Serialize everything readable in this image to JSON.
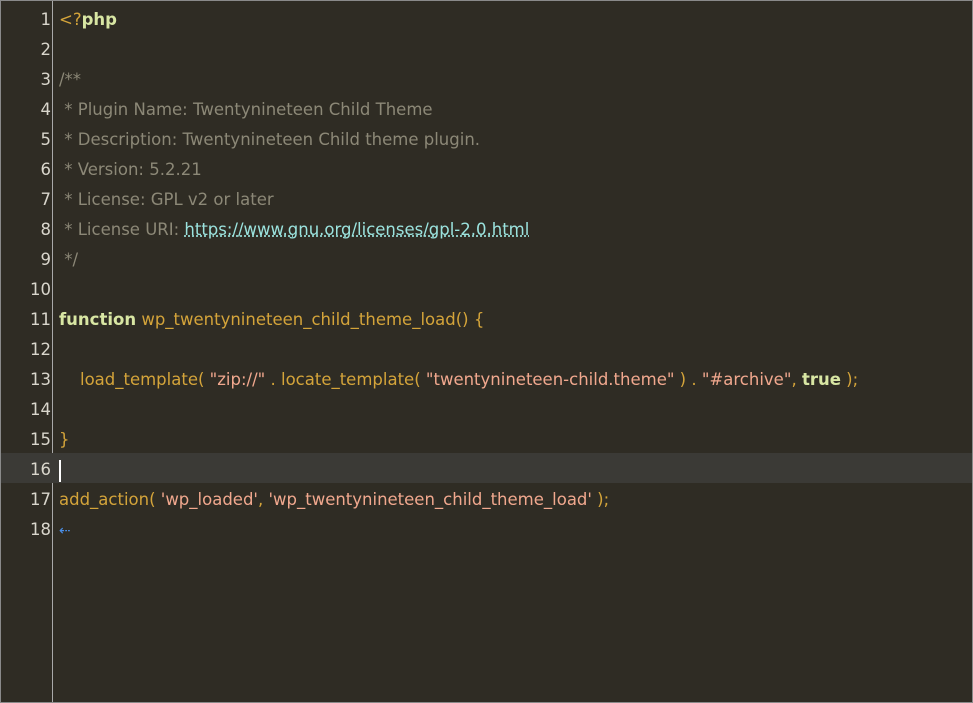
{
  "editor": {
    "lines": [
      {
        "num": "1",
        "parts": [
          {
            "t": "<?",
            "c": "tag"
          },
          {
            "t": "php",
            "c": "kw"
          }
        ]
      },
      {
        "num": "2",
        "parts": []
      },
      {
        "num": "3",
        "parts": [
          {
            "t": "/**",
            "c": "cmt"
          }
        ]
      },
      {
        "num": "4",
        "parts": [
          {
            "t": " * Plugin Name: Twentynineteen Child Theme",
            "c": "cmt"
          }
        ]
      },
      {
        "num": "5",
        "parts": [
          {
            "t": " * Description: Twentynineteen Child theme plugin.",
            "c": "cmt"
          }
        ]
      },
      {
        "num": "6",
        "parts": [
          {
            "t": " * Version: 5.2.21",
            "c": "cmt"
          }
        ]
      },
      {
        "num": "7",
        "parts": [
          {
            "t": " * License: GPL v2 or later",
            "c": "cmt"
          }
        ]
      },
      {
        "num": "8",
        "parts": [
          {
            "t": " * License URI: ",
            "c": "cmt"
          },
          {
            "t": "https://www.gnu.org/licenses/gpl-2.0.html",
            "c": "link"
          }
        ]
      },
      {
        "num": "9",
        "parts": [
          {
            "t": " */",
            "c": "cmt"
          }
        ]
      },
      {
        "num": "10",
        "parts": []
      },
      {
        "num": "11",
        "parts": [
          {
            "t": "function",
            "c": "kw"
          },
          {
            "t": " wp_twentynineteen_child_theme_load() {",
            "c": "fn"
          }
        ]
      },
      {
        "num": "12",
        "parts": []
      },
      {
        "num": "13",
        "parts": [
          {
            "t": "    load_template( ",
            "c": "fn"
          },
          {
            "t": "\"zip://\"",
            "c": "str"
          },
          {
            "t": " . locate_template( ",
            "c": "fn"
          },
          {
            "t": "\"twentynineteen-child.theme\"",
            "c": "str"
          },
          {
            "t": " ) . ",
            "c": "fn"
          },
          {
            "t": "\"#archive\"",
            "c": "str"
          },
          {
            "t": ", ",
            "c": "fn"
          },
          {
            "t": "true",
            "c": "bool"
          },
          {
            "t": " );",
            "c": "fn"
          }
        ]
      },
      {
        "num": "14",
        "parts": []
      },
      {
        "num": "15",
        "parts": [
          {
            "t": "}",
            "c": "punc"
          }
        ]
      },
      {
        "num": "16",
        "parts": [],
        "current": true
      },
      {
        "num": "17",
        "parts": [
          {
            "t": "add_action( ",
            "c": "fn"
          },
          {
            "t": "'wp_loaded'",
            "c": "str"
          },
          {
            "t": ", ",
            "c": "fn"
          },
          {
            "t": "'wp_twentynineteen_child_theme_load'",
            "c": "str"
          },
          {
            "t": " );",
            "c": "fn"
          }
        ]
      },
      {
        "num": "18",
        "parts": [
          {
            "t": "⇠",
            "c": "eol-icon"
          }
        ]
      }
    ]
  }
}
